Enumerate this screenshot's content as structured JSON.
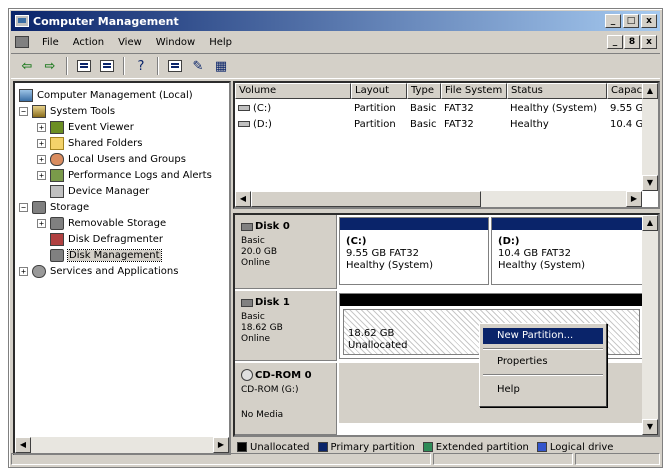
{
  "window": {
    "title": "Computer Management",
    "controls": [
      "_",
      "□",
      "x"
    ]
  },
  "menubar": {
    "items": [
      "File",
      "Action",
      "View",
      "Window",
      "Help"
    ],
    "mdi_controls": [
      "_",
      "8",
      "x"
    ]
  },
  "toolbar": {
    "icons": [
      "back-arrow-icon",
      "forward-arrow-icon",
      "up-folder-icon",
      "show-tree-icon",
      "help-icon",
      "properties-icon",
      "refresh-icon",
      "export-icon"
    ]
  },
  "tree": {
    "root": "Computer Management (Local)",
    "system_tools": "System Tools",
    "event_viewer": "Event Viewer",
    "shared_folders": "Shared Folders",
    "local_users": "Local Users and Groups",
    "perf_logs": "Performance Logs and Alerts",
    "device_manager": "Device Manager",
    "storage": "Storage",
    "removable_storage": "Removable Storage",
    "disk_defragmenter": "Disk Defragmenter",
    "disk_management": "Disk Management",
    "services": "Services and Applications"
  },
  "volumes": {
    "headers": [
      "Volume",
      "Layout",
      "Type",
      "File System",
      "Status",
      "Capaci"
    ],
    "rows": [
      [
        "(C:)",
        "Partition",
        "Basic",
        "FAT32",
        "Healthy (System)",
        "9.55 G"
      ],
      [
        "(D:)",
        "Partition",
        "Basic",
        "FAT32",
        "Healthy",
        "10.4 G"
      ]
    ]
  },
  "disks": {
    "disk0": {
      "name": "Disk 0",
      "type": "Basic",
      "size": "20.0 GB",
      "state": "Online",
      "partitions": [
        {
          "name": "(C:)",
          "size": "9.55 GB FAT32",
          "status": "Healthy (System)"
        },
        {
          "name": "(D:)",
          "size": "10.4 GB FAT32",
          "status": "Healthy (System)"
        }
      ]
    },
    "disk1": {
      "name": "Disk 1",
      "type": "Basic",
      "size": "18.62 GB",
      "state": "Online",
      "unalloc_size": "18.62 GB",
      "unalloc_label": "Unallocated"
    },
    "cdrom": {
      "name": "CD-ROM 0",
      "drive": "CD-ROM (G:)",
      "media": "No Media"
    }
  },
  "context_menu": {
    "new_partition": "New Partition...",
    "properties": "Properties",
    "help": "Help"
  },
  "legend": {
    "items": [
      {
        "label": "Unallocated",
        "color": "#000000"
      },
      {
        "label": "Primary partition",
        "color": "#0a246a"
      },
      {
        "label": "Extended partition",
        "color": "#2e8b57"
      },
      {
        "label": "Logical drive",
        "color": "#3355cc"
      }
    ]
  }
}
